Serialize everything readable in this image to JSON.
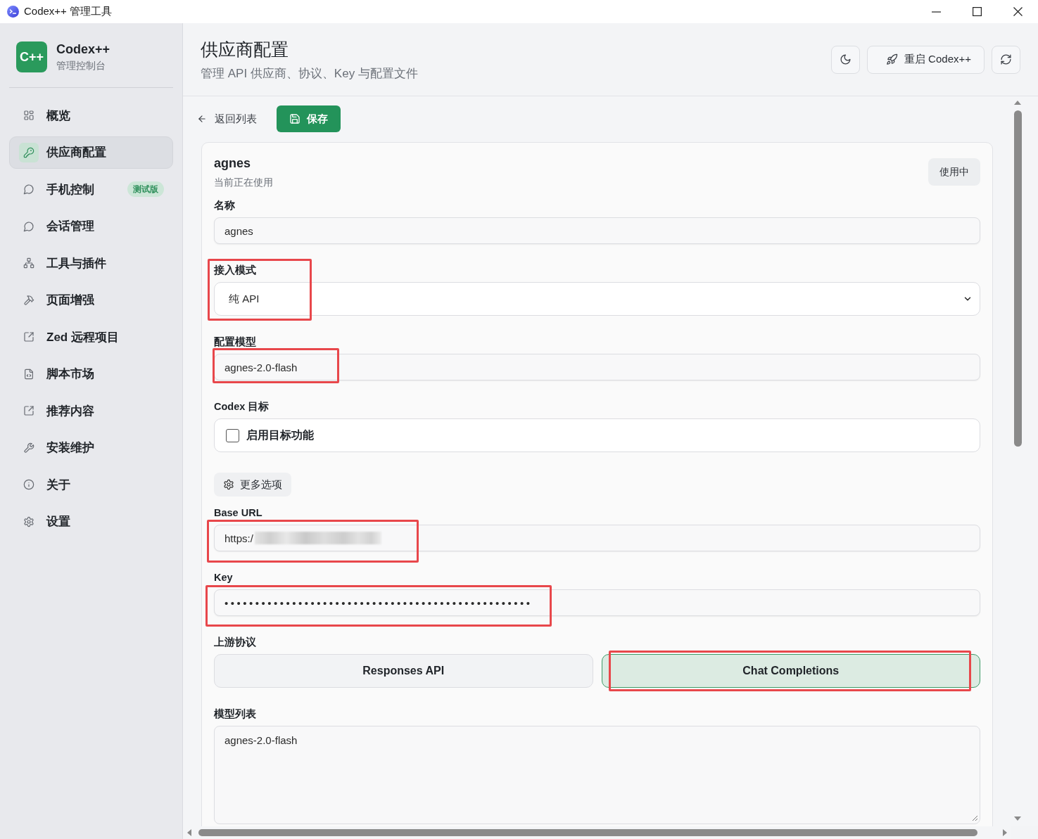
{
  "window": {
    "title": "Codex++ 管理工具"
  },
  "sidebar": {
    "brand": {
      "logo": "C++",
      "name": "Codex++",
      "subtitle": "管理控制台"
    },
    "items": [
      {
        "label": "概览",
        "selected": false
      },
      {
        "label": "供应商配置",
        "selected": true
      },
      {
        "label": "手机控制",
        "badge": "测试版",
        "selected": false
      },
      {
        "label": "会话管理",
        "selected": false
      },
      {
        "label": "工具与插件",
        "selected": false
      },
      {
        "label": "页面增强",
        "selected": false
      },
      {
        "label": "Zed 远程项目",
        "selected": false
      },
      {
        "label": "脚本市场",
        "selected": false
      },
      {
        "label": "推荐内容",
        "selected": false
      },
      {
        "label": "安装维护",
        "selected": false
      },
      {
        "label": "关于",
        "selected": false
      },
      {
        "label": "设置",
        "selected": false
      }
    ]
  },
  "header": {
    "title": "供应商配置",
    "subtitle": "管理 API 供应商、协议、Key 与配置文件",
    "restart_button": "重启 Codex++"
  },
  "toolbar": {
    "back": "返回列表",
    "save": "保存"
  },
  "provider": {
    "name": "agnes",
    "status": "当前正在使用",
    "badge": "使用中",
    "fields": [
      {
        "kind": "text",
        "label": "名称",
        "value": "agnes",
        "highlighted": false
      },
      {
        "kind": "select",
        "label": "接入模式",
        "value": "纯 API",
        "highlighted": true
      },
      {
        "kind": "text",
        "label": "配置模型",
        "value": "agnes-2.0-flash",
        "highlighted": true
      },
      {
        "kind": "checkbox",
        "label": "Codex 目标",
        "option": "启用目标功能",
        "checked": false
      },
      {
        "kind": "button",
        "label": "更多选项"
      },
      {
        "kind": "text",
        "label": "Base URL",
        "value": "https:/",
        "redacted": true,
        "highlighted": true
      },
      {
        "kind": "password",
        "label": "Key",
        "value": "••••••••••••••••••••••••••••••••••••••••••••••••••",
        "highlighted": true
      },
      {
        "kind": "segmented",
        "label": "上游协议",
        "options": [
          {
            "label": "Responses API",
            "selected": false,
            "highlighted": false
          },
          {
            "label": "Chat Completions",
            "selected": true,
            "highlighted": true
          }
        ]
      },
      {
        "kind": "textarea",
        "label": "模型列表",
        "value": "agnes-2.0-flash"
      }
    ]
  }
}
